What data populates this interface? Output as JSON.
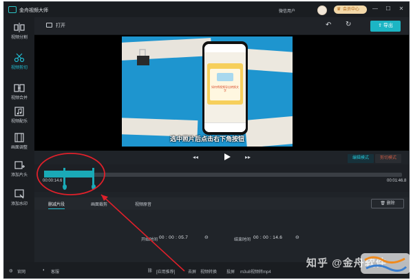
{
  "app": {
    "title": "金舟视频大师",
    "login": "微信用户",
    "member": "会员中心",
    "window": {
      "minimize": "—",
      "maximize": "☐",
      "close": "✕"
    }
  },
  "sidebar": {
    "items": [
      {
        "label": "视频分割",
        "icon": "split-icon",
        "active": false
      },
      {
        "label": "视频剪切",
        "icon": "cut-icon",
        "active": true
      },
      {
        "label": "视频合并",
        "icon": "merge-icon",
        "active": false
      },
      {
        "label": "视频配乐",
        "icon": "music-icon",
        "active": false
      },
      {
        "label": "画面调整",
        "icon": "adjust-icon",
        "active": false
      },
      {
        "label": "添加片头",
        "icon": "intro-icon",
        "active": false
      },
      {
        "label": "添加水印",
        "icon": "watermark-icon",
        "active": false
      }
    ]
  },
  "toolbar": {
    "open_label": "打开",
    "undo_glyph": "↶",
    "redo_glyph": "↻",
    "export_label": "导出"
  },
  "preview": {
    "caption": "选中照片后点击右下角按钮",
    "phone_card_title": "如何将视频导出转换文字"
  },
  "controls": {
    "rewind_glyph": "◂◂",
    "forward_glyph": "▸▸",
    "mode_edit": "编辑模式",
    "mode_pro": "剪切模式"
  },
  "timeline": {
    "start_time": "00:00:14.6",
    "end_time": "00:01:46.8",
    "selection_start_fraction": 0.0,
    "selection_end_fraction": 0.137
  },
  "tabs": {
    "items": [
      "删减片段",
      "画面裁剪",
      "视频原音"
    ],
    "active_index": 0,
    "delete_label": "删除"
  },
  "panel": {
    "start_label": "开始时间",
    "start_value": "00 : 00 : 05.7",
    "end_label": "结束时间",
    "end_value": "00 : 00 : 14.6"
  },
  "statusbar": {
    "official": "官网",
    "service": "客服",
    "recommend": "[应用推荐]",
    "links": [
      "去屏",
      "视频转换",
      "投屏",
      "m3u8视频转mp4"
    ]
  },
  "watermark": {
    "text": "知乎 @金舟软件"
  }
}
